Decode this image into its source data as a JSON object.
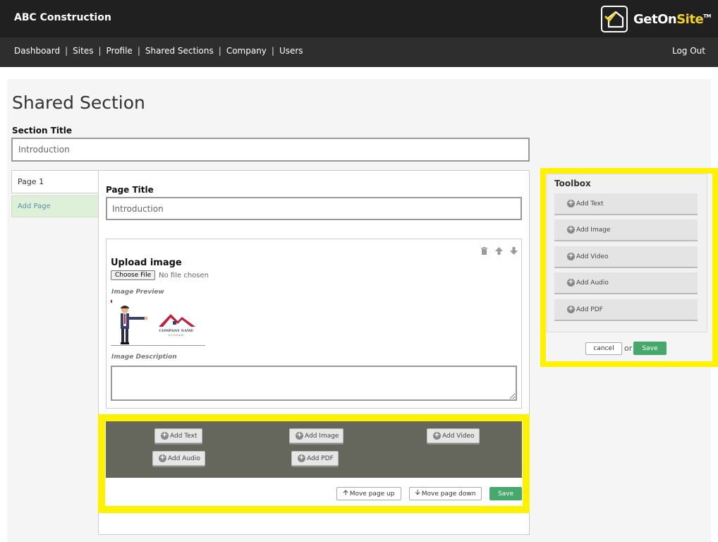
{
  "header": {
    "company": "ABC Construction",
    "logo_get_on": "GetOn",
    "logo_site": "Site",
    "logo_tm": "TM"
  },
  "nav": {
    "items": [
      "Dashboard",
      "Sites",
      "Profile",
      "Shared Sections",
      "Company",
      "Users"
    ],
    "separator": "|",
    "logout": "Log Out"
  },
  "page": {
    "heading": "Shared Section",
    "section_title_label": "Section Title",
    "section_title_value": "Introduction"
  },
  "pages": {
    "tab": "Page 1",
    "add_page": "Add Page"
  },
  "editor": {
    "page_title_label": "Page Title",
    "page_title_value": "Introduction",
    "upload_label": "Upload image",
    "choose_file": "Choose File",
    "no_file": "No file chosen",
    "image_preview_label": "Image Preview",
    "image_description_label": "Image Description",
    "preview_logo_line1": "COMPANY NAME",
    "preview_logo_line2": "SLOGAN"
  },
  "add_area": {
    "add_text": "Add Text",
    "add_image": "Add Image",
    "add_video": "Add Video",
    "add_audio": "Add Audio",
    "add_pdf": "Add PDF"
  },
  "page_actions": {
    "move_up": "Move page up",
    "move_down": "Move page down",
    "save": "Save"
  },
  "toolbox": {
    "title": "Toolbox",
    "items": [
      "Add Text",
      "Add Image",
      "Add Video",
      "Add Audio",
      "Add PDF"
    ],
    "cancel": "cancel",
    "or": "or",
    "save": "Save"
  },
  "colors": {
    "header_bg": "#202020",
    "nav_bg": "#2e2e2e",
    "accent_yellow": "#f5d21e",
    "highlight": "#fff200",
    "save_green": "#46a86a",
    "add_area_bg": "#65665c"
  }
}
